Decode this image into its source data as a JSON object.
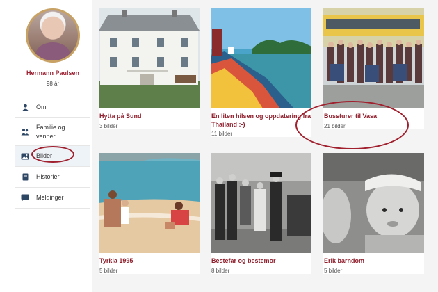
{
  "profile": {
    "name": "Hermann Paulsen",
    "age": "98 år"
  },
  "nav": {
    "items": [
      {
        "label": "Om",
        "icon": "person-icon"
      },
      {
        "label": "Familie og venner",
        "icon": "people-icon"
      },
      {
        "label": "Bilder",
        "icon": "photos-icon",
        "active": true
      },
      {
        "label": "Historier",
        "icon": "book-icon"
      },
      {
        "label": "Meldinger",
        "icon": "chat-icon"
      }
    ]
  },
  "albums": [
    {
      "title": "Hytta på Sund",
      "count": "3 bilder"
    },
    {
      "title": "En liten hilsen og oppdatering fra Thailand :-)",
      "count": "11 bilder"
    },
    {
      "title": "Bussturer til Vasa",
      "count": "21 bilder"
    },
    {
      "title": "Tyrkia 1995",
      "count": "5 bilder"
    },
    {
      "title": "Bestefar og bestemor",
      "count": "8 bilder"
    },
    {
      "title": "Erik barndom",
      "count": "5 bilder"
    }
  ],
  "colors": {
    "accent": "#8f1f2c",
    "annotation": "#a0202e",
    "background": "#f4f4f4"
  }
}
